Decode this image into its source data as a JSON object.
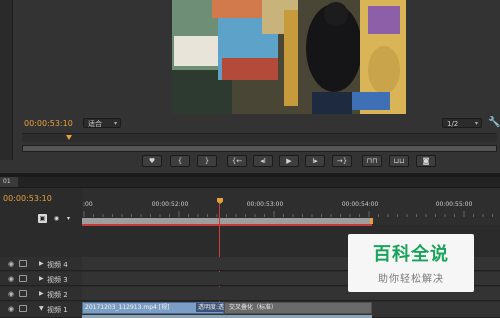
{
  "monitor": {
    "timecode": "00:00:53:10",
    "fit_dropdown": "适合",
    "resolution_dropdown": "1/2",
    "transport_buttons": [
      {
        "name": "add-marker-button",
        "glyph": "♥"
      },
      {
        "name": "mark-in-button",
        "glyph": "{"
      },
      {
        "name": "mark-out-button",
        "glyph": "}"
      },
      {
        "name": "go-to-in-button",
        "glyph": "{←"
      },
      {
        "name": "step-back-button",
        "glyph": "◂I"
      },
      {
        "name": "play-button",
        "glyph": "▶"
      },
      {
        "name": "step-forward-button",
        "glyph": "I▸"
      },
      {
        "name": "go-to-out-button",
        "glyph": "→}"
      },
      {
        "name": "lift-button",
        "glyph": "⊓⊓"
      },
      {
        "name": "extract-button",
        "glyph": "⊔⊔"
      },
      {
        "name": "export-frame-button",
        "glyph": "◙"
      }
    ]
  },
  "timeline": {
    "tab_label": "01",
    "timecode": "00:00:53:10",
    "ruler_labels": [
      ":00",
      "00:00:52:00",
      "00:00:53:00",
      "00:00:54:00",
      "00:00:55:00"
    ],
    "tracks": [
      {
        "label": "视频 4"
      },
      {
        "label": "视频 3"
      },
      {
        "label": "视频 2"
      },
      {
        "label": "视频 1"
      }
    ],
    "clip": {
      "name": "20171203_112913.mp4",
      "tag": "[视]",
      "effect": "透明度:透明度",
      "transition": "交叉叠化（标准）"
    }
  },
  "watermark": {
    "title": "百科全说",
    "subtitle": "助你轻松解决"
  },
  "colors": {
    "timecode": "#e8a13a",
    "playhead": "#d23a3a",
    "clip": "#7d9ec4",
    "watermark_green": "#1aa35a"
  }
}
